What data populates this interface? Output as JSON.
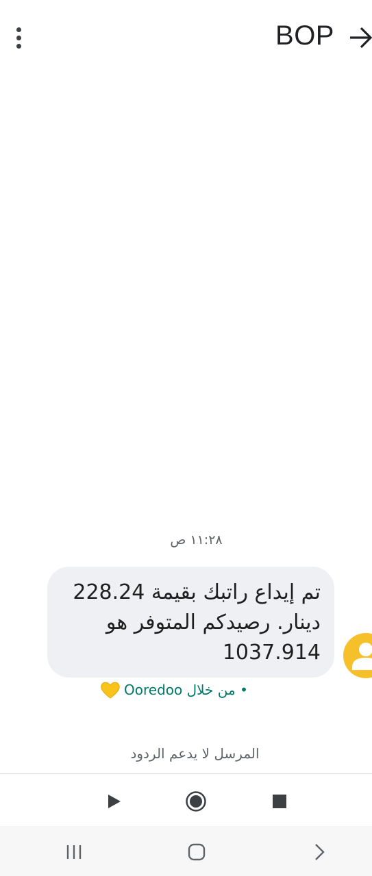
{
  "header": {
    "title": "BOP",
    "back_icon": "arrow-forward-icon",
    "menu_icon": "more-vert-icon"
  },
  "conversation": {
    "timestamp": "١١:٢٨ ص",
    "message": {
      "lines": [
        "تم إيداع راتبك بقيمة 228.24",
        "دينار. رصيدكم المتوفر هو",
        "1037.914"
      ]
    },
    "via_label": "• من خلال Ooredoo",
    "via_icon": "yellow-heart-icon",
    "no_reply_notice": "المرسل لا يدعم الردود"
  },
  "media_controls": {
    "icons": [
      "play-icon",
      "record-icon",
      "stop-icon"
    ]
  },
  "system_nav": {
    "icons": [
      "recent-apps-icon",
      "home-icon",
      "back-chevron-icon"
    ]
  },
  "colors": {
    "bubble_bg": "#eef0f3",
    "avatar": "#f6c02b",
    "via_text": "#00796b",
    "navbar_bg": "#f7f7f7"
  }
}
